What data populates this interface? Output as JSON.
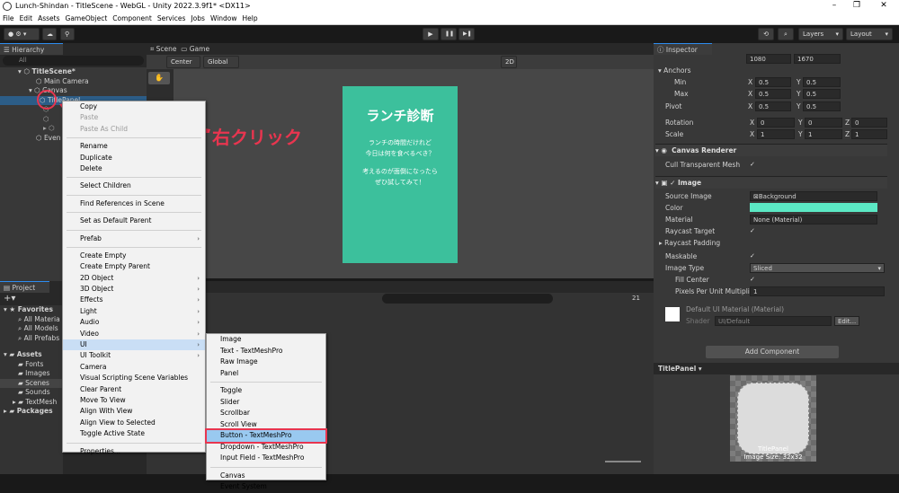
{
  "window": {
    "title": "Lunch-Shindan - TitleScene - WebGL - Unity 2022.3.9f1* <DX11>",
    "min": "–",
    "max": "❐",
    "close": "✕"
  },
  "menu": [
    "File",
    "Edit",
    "Assets",
    "GameObject",
    "Component",
    "Services",
    "Jobs",
    "Window",
    "Help"
  ],
  "toolbar": {
    "layers": "Layers",
    "layout": "Layout",
    "play": "▶",
    "pause": "❚❚",
    "step": "▶❚"
  },
  "hierarchy": {
    "tab": "Hierarchy",
    "search": "All",
    "scene": "TitleScene*",
    "items": [
      "Main Camera",
      "Canvas",
      "TitlePanel"
    ],
    "events": "Even"
  },
  "scene_tabs": {
    "scene": "Scene",
    "game": "Game",
    "center": "Center",
    "global": "Global",
    "mode2d": "2D"
  },
  "game_panel": {
    "title": "ランチ診断",
    "line1": "ランチの時間だけれど",
    "line2": "今日は何を食べるべき？",
    "line3": "考えるのが面倒になったら",
    "line4": "ぜひ試してみて！",
    "color": "#3cc09c"
  },
  "annotation": {
    "text": "右クリック",
    "color": "#e8354f"
  },
  "context_menu": {
    "items": [
      {
        "label": "Copy",
        "disabled": false,
        "sub": false
      },
      {
        "label": "Paste",
        "disabled": true,
        "sub": false
      },
      {
        "label": "Paste As Child",
        "disabled": true,
        "sub": false
      },
      {
        "sep": true
      },
      {
        "label": "Rename",
        "disabled": false,
        "sub": false
      },
      {
        "label": "Duplicate",
        "disabled": false,
        "sub": false
      },
      {
        "label": "Delete",
        "disabled": false,
        "sub": false
      },
      {
        "sep": true
      },
      {
        "label": "Select Children",
        "disabled": false,
        "sub": false
      },
      {
        "sep": true
      },
      {
        "label": "Find References in Scene",
        "disabled": false,
        "sub": false
      },
      {
        "sep": true
      },
      {
        "label": "Set as Default Parent",
        "disabled": false,
        "sub": false
      },
      {
        "sep": true
      },
      {
        "label": "Prefab",
        "disabled": false,
        "sub": true
      },
      {
        "sep": true
      },
      {
        "label": "Create Empty",
        "disabled": false,
        "sub": false
      },
      {
        "label": "Create Empty Parent",
        "disabled": false,
        "sub": false
      },
      {
        "label": "2D Object",
        "disabled": false,
        "sub": true
      },
      {
        "label": "3D Object",
        "disabled": false,
        "sub": true
      },
      {
        "label": "Effects",
        "disabled": false,
        "sub": true
      },
      {
        "label": "Light",
        "disabled": false,
        "sub": true
      },
      {
        "label": "Audio",
        "disabled": false,
        "sub": true
      },
      {
        "label": "Video",
        "disabled": false,
        "sub": true
      },
      {
        "label": "UI",
        "disabled": false,
        "sub": true,
        "highlight": true
      },
      {
        "label": "UI Toolkit",
        "disabled": false,
        "sub": true
      },
      {
        "label": "Camera",
        "disabled": false,
        "sub": false
      },
      {
        "label": "Visual Scripting Scene Variables",
        "disabled": false,
        "sub": false
      },
      {
        "label": "Clear Parent",
        "disabled": false,
        "sub": false
      },
      {
        "label": "Move To View",
        "disabled": false,
        "sub": false
      },
      {
        "label": "Align With View",
        "disabled": false,
        "sub": false
      },
      {
        "label": "Align View to Selected",
        "disabled": false,
        "sub": false
      },
      {
        "label": "Toggle Active State",
        "disabled": false,
        "sub": false
      },
      {
        "sep": true
      },
      {
        "label": "Properties...",
        "disabled": false,
        "sub": false
      }
    ]
  },
  "ui_submenu": {
    "items": [
      {
        "label": "Image"
      },
      {
        "label": "Text - TextMeshPro"
      },
      {
        "label": "Raw Image"
      },
      {
        "label": "Panel"
      },
      {
        "sep": true
      },
      {
        "label": "Toggle"
      },
      {
        "label": "Slider"
      },
      {
        "label": "Scrollbar"
      },
      {
        "label": "Scroll View"
      },
      {
        "label": "Button - TextMeshPro",
        "selected": true
      },
      {
        "label": "Dropdown - TextMeshPro"
      },
      {
        "label": "Input Field - TextMeshPro"
      },
      {
        "sep": true
      },
      {
        "label": "Canvas"
      },
      {
        "label": "Event System"
      }
    ]
  },
  "project": {
    "tab": "Project",
    "favorites": "Favorites",
    "fav_items": [
      "All Materia",
      "All Models",
      "All Prefabs"
    ],
    "assets": "Assets",
    "asset_items": [
      "Fonts",
      "Images",
      "Scenes",
      "Sounds",
      "TextMesh"
    ],
    "packages": "Packages",
    "count": "21"
  },
  "inspector": {
    "tab": "Inspector",
    "size_w": "1080",
    "size_h": "1670",
    "anchors": "Anchors",
    "min": "Min",
    "max": "Max",
    "pivot": "Pivot",
    "rotation": "Rotation",
    "scale": "Scale",
    "min_x": "0.5",
    "min_y": "0.5",
    "max_x": "0.5",
    "max_y": "0.5",
    "pivot_x": "0.5",
    "pivot_y": "0.5",
    "rot_x": "0",
    "rot_y": "0",
    "rot_z": "0",
    "scale_x": "1",
    "scale_y": "1",
    "scale_z": "1",
    "canvas_renderer": "Canvas Renderer",
    "cull": "Cull Transparent Mesh",
    "image": "Image",
    "source_image": "Source Image",
    "source_value": "Background",
    "color": "Color",
    "color_value": "#5be8c4",
    "material": "Material",
    "material_value": "None (Material)",
    "raycast_target": "Raycast Target",
    "raycast_padding": "Raycast Padding",
    "maskable": "Maskable",
    "image_type": "Image Type",
    "image_type_value": "Sliced",
    "fill_center": "Fill Center",
    "ppu": "Pixels Per Unit Multipli",
    "ppu_value": "1",
    "default_mat": "Default UI Material (Material)",
    "shader": "Shader",
    "shader_value": "UI/Default",
    "edit": "Edit...",
    "add_component": "Add Component",
    "preview_title": "TitlePanel",
    "preview_name": "TitlePanel",
    "preview_size": "Image Size: 32x32",
    "label_x": "X",
    "label_y": "Y",
    "label_z": "Z"
  }
}
